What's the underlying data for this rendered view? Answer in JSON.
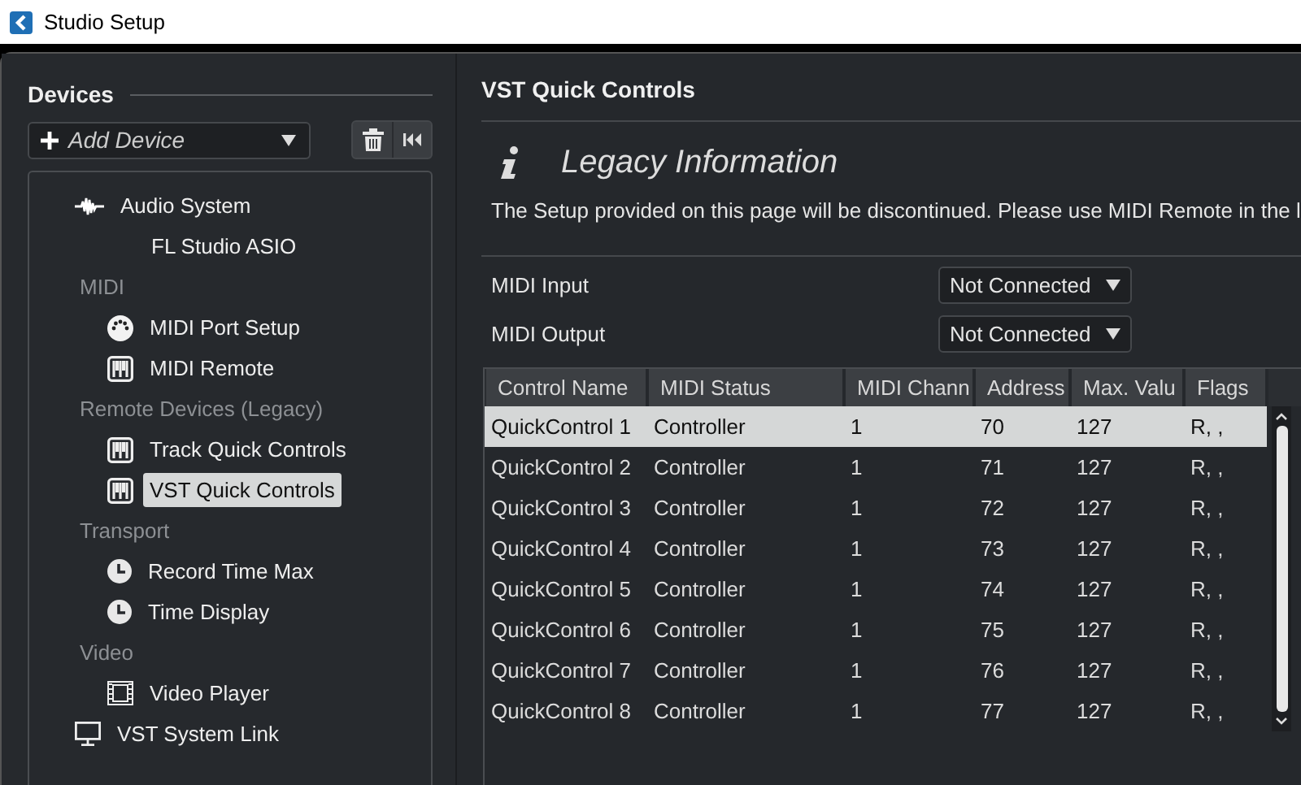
{
  "window": {
    "title": "Studio Setup"
  },
  "sidebar": {
    "heading": "Devices",
    "add_device": {
      "label": "Add Device"
    },
    "tree": [
      {
        "label": "Audio System",
        "kind": "item",
        "selected": false,
        "children": [
          {
            "label": "FL Studio ASIO",
            "kind": "item",
            "selected": false
          }
        ]
      },
      {
        "label": "MIDI",
        "kind": "group",
        "children": [
          {
            "label": "MIDI Port Setup",
            "kind": "item",
            "selected": false
          },
          {
            "label": "MIDI Remote",
            "kind": "item",
            "selected": false
          }
        ]
      },
      {
        "label": "Remote Devices (Legacy)",
        "kind": "group",
        "children": [
          {
            "label": "Track Quick Controls",
            "kind": "item",
            "selected": false
          },
          {
            "label": "VST Quick Controls",
            "kind": "item",
            "selected": true
          }
        ]
      },
      {
        "label": "Transport",
        "kind": "group",
        "children": [
          {
            "label": "Record Time Max",
            "kind": "item",
            "selected": false
          },
          {
            "label": "Time Display",
            "kind": "item",
            "selected": false
          }
        ]
      },
      {
        "label": "Video",
        "kind": "group",
        "children": [
          {
            "label": "Video Player",
            "kind": "item",
            "selected": false
          }
        ]
      },
      {
        "label": "VST System Link",
        "kind": "item",
        "selected": false
      }
    ]
  },
  "main": {
    "title": "VST Quick Controls",
    "info": {
      "heading": "Legacy Information",
      "text": "The Setup provided on this page will be discontinued. Please use MIDI Remote in the l"
    },
    "settings": [
      {
        "label": "MIDI Input",
        "value": "Not Connected"
      },
      {
        "label": "MIDI Output",
        "value": "Not Connected"
      }
    ],
    "table": {
      "columns": [
        "Control Name",
        "MIDI Status",
        "MIDI Chann",
        "Address",
        "Max. Valu",
        "Flags"
      ],
      "rows": [
        {
          "cells": [
            "QuickControl 1",
            "Controller",
            "1",
            "70",
            "127",
            "R, ,"
          ],
          "selected": true
        },
        {
          "cells": [
            "QuickControl 2",
            "Controller",
            "1",
            "71",
            "127",
            "R, ,"
          ],
          "selected": false
        },
        {
          "cells": [
            "QuickControl 3",
            "Controller",
            "1",
            "72",
            "127",
            "R, ,"
          ],
          "selected": false
        },
        {
          "cells": [
            "QuickControl 4",
            "Controller",
            "1",
            "73",
            "127",
            "R, ,"
          ],
          "selected": false
        },
        {
          "cells": [
            "QuickControl 5",
            "Controller",
            "1",
            "74",
            "127",
            "R, ,"
          ],
          "selected": false
        },
        {
          "cells": [
            "QuickControl 6",
            "Controller",
            "1",
            "75",
            "127",
            "R, ,"
          ],
          "selected": false
        },
        {
          "cells": [
            "QuickControl 7",
            "Controller",
            "1",
            "76",
            "127",
            "R, ,"
          ],
          "selected": false
        },
        {
          "cells": [
            "QuickControl 8",
            "Controller",
            "1",
            "77",
            "127",
            "R, ,"
          ],
          "selected": false
        }
      ]
    }
  }
}
